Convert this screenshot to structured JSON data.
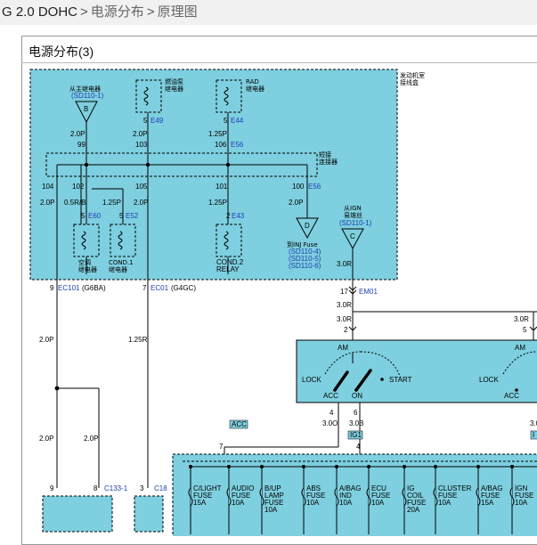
{
  "breadcrumb": {
    "model": "G 2.0 DOHC",
    "sep": ">",
    "level1": "电源分布",
    "level2": "原理图"
  },
  "panel": {
    "title": "电源分布(3)"
  },
  "diagram": {
    "engine_box": "发动机室\n接线盒",
    "main_relay": "从主继电器",
    "main_relay_ref": "(SD110-1)",
    "conn_b": "B",
    "fuel_pump_relay": "燃油泵\n继电器",
    "rad_relay": "RAD\n继电器",
    "e49": "E49",
    "e44": "E44",
    "e56": "E56",
    "pin5a": "5",
    "pin5b": "5",
    "w20p_a": "2.0P",
    "w20p_b": "2.0P",
    "w125p_a": "1.25P",
    "pin99": "99",
    "pin103": "103",
    "pin106": "106",
    "short_conn": "短接\n连接器",
    "pin104": "104",
    "pin102": "102",
    "pin105": "105",
    "pin101": "101",
    "pin100": "100",
    "e56b": "E56",
    "w20p_c": "2.0P",
    "w05rb": "0.5R/B",
    "w125p_b": "1.25P",
    "w20p_d": "2.0P",
    "w125p_c": "1.25P",
    "w20p_e": "2.0P",
    "pin5c": "5",
    "e60": "E60",
    "pin5d": "5",
    "e52": "E52",
    "pin2a": "2",
    "e43": "E43",
    "ac_relay": "空调\n继电器",
    "cond1_relay": "COND.1\n继电器",
    "cond2_relay": "COND.2\nRELAY",
    "conn_d": "D",
    "to_inj": "到INJ Fuse",
    "to_inj_ref": "(SD110-4)\n(SD110-5)\n(SD110-6)",
    "from_ign": "从IGN\n易熔丝",
    "from_ign_ref": "(SD110-1)",
    "conn_c": "C",
    "w30r_a": "3.0R",
    "pin9": "9",
    "ec101": "EC101",
    "ec101_type": "(G6BA)",
    "pin7": "7",
    "ec01": "EC01",
    "ec01_type": "(G4GC)",
    "pin17": "17",
    "em01": "EM01",
    "w30r_b": "3.0R",
    "w30r_c": "3.0R",
    "pin2b": "2",
    "w30r_d": "3.0R",
    "pin5e": "5",
    "w20p_f": "2.0P",
    "w125r": "1.25R",
    "am1": "AM",
    "am2": "AM",
    "lock1": "LOCK",
    "lock2": "LOCK",
    "start": "START",
    "acc1": "ACC",
    "on1": "ON",
    "acc2": "ACC",
    "pin4a": "4",
    "pin6": "6",
    "w30o": "3.0O",
    "w30b": "3.0B",
    "w3x": "3.0",
    "acc_tag": "ACC",
    "ig1_tag": "IG1",
    "i_tag": "I",
    "pin7b": "7",
    "pin4b": "4",
    "w20p_g": "2.0P",
    "w20p_h": "2.0P",
    "pin9b": "9",
    "pin8": "8",
    "c133": "C133-1",
    "pin3": "3",
    "c18": "C18",
    "fuses": [
      {
        "name": "C/LIGHT\nFUSE",
        "amp": "15A"
      },
      {
        "name": "AUDIO\nFUSE",
        "amp": "10A"
      },
      {
        "name": "B/UP\nLAMP\nFUSE",
        "amp": "10A"
      },
      {
        "name": "ABS\nFUSE",
        "amp": "10A"
      },
      {
        "name": "A/BAG\nIND",
        "amp": "10A"
      },
      {
        "name": "ECU\nFUSE",
        "amp": "10A"
      },
      {
        "name": "IG\nCOIL\nFUSE",
        "amp": "20A"
      },
      {
        "name": "CLUSTER\nFUSE",
        "amp": "10A"
      },
      {
        "name": "A/BAG\nFUSE",
        "amp": "15A"
      },
      {
        "name": "IGN\nFUSE",
        "amp": "10A"
      }
    ],
    "colors": {
      "box_fill": "#7ecfdf",
      "wire": "#000000",
      "label_blue": "#1f3fb0",
      "tag_fill": "#7ecfdf"
    }
  }
}
